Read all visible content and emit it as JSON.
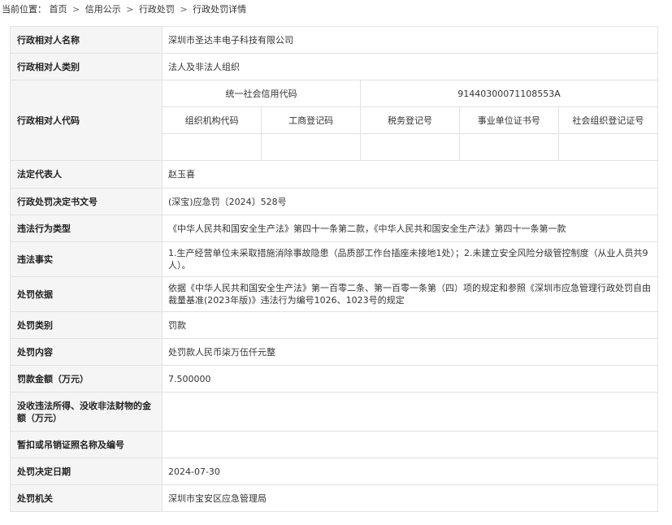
{
  "breadcrumb": {
    "prefix": "当前位置：",
    "items": [
      "首页",
      "信用公示",
      "行政处罚",
      "行政处罚详情"
    ],
    "separator": ">"
  },
  "record": {
    "party_name_label": "行政相对人名称",
    "party_name": "深圳市圣达丰电子科技有限公司",
    "party_type_label": "行政相对人类别",
    "party_type": "法人及非法人组织",
    "party_code_label": "行政相对人代码",
    "credit_code_label": "统一社会信用代码",
    "credit_code": "91440300071108553A",
    "code_headers": [
      "组织机构代码",
      "工商登记码",
      "税务登记号",
      "事业单位证书号",
      "社会组织登记证号"
    ],
    "legal_rep_label": "法定代表人",
    "legal_rep": "赵玉喜",
    "decision_no_label": "行政处罚决定书文号",
    "decision_no": "(深宝)应急罚〔2024〕528号",
    "violation_type_label": "违法行为类型",
    "violation_type": "《中华人民共和国安全生产法》第四十一条第二款，《中华人民共和国安全生产法》第四十一条第一款",
    "facts_label": "违法事实",
    "facts": "1.生产经营单位未采取措施消除事故隐患（品质部工作台插座未接地1处）；2.未建立安全风险分级管控制度（从业人员共9人）。",
    "basis_label": "处罚依据",
    "basis": "依据《中华人民共和国安全生产法》第一百零二条、第一百零一条第（四）项的规定和参照《深圳市应急管理行政处罚自由裁量基准(2023年版)》违法行为编号1026、1023号的规定",
    "penalty_type_label": "处罚类别",
    "penalty_type": "罚款",
    "penalty_content_label": "处罚内容",
    "penalty_content": "处罚款人民币柒万伍仟元整",
    "fine_label": "罚款金额（万元）",
    "fine": "7.500000",
    "confiscation_label": "没收违法所得、没收非法财物的金额（万元）",
    "confiscation": "",
    "license_label": "暂扣或吊销证照名称及编号",
    "license": "",
    "decision_date_label": "处罚决定日期",
    "decision_date": "2024-07-30",
    "authority_label": "处罚机关",
    "authority": "深圳市宝安区应急管理局"
  }
}
